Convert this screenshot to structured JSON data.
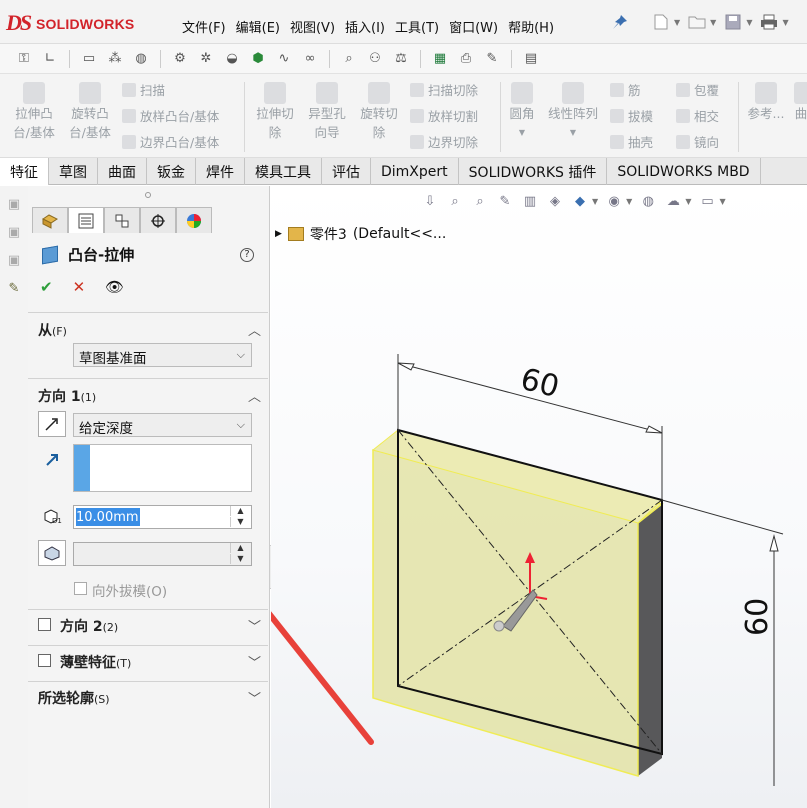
{
  "app": {
    "brand_ds": "DS",
    "brand_name": "SOLIDWORKS"
  },
  "menu": [
    "文件(F)",
    "编辑(E)",
    "视图(V)",
    "插入(I)",
    "工具(T)",
    "窗口(W)",
    "帮助(H)"
  ],
  "command_manager": {
    "big_buttons": [
      {
        "line1": "拉伸凸",
        "line2": "台/基体"
      },
      {
        "line1": "旋转凸",
        "line2": "台/基体"
      },
      {
        "line1": "拉伸切",
        "line2": "除"
      },
      {
        "line1": "异型孔",
        "line2": "向导"
      },
      {
        "line1": "旋转切",
        "line2": "除"
      }
    ],
    "small_buttons_col1": [
      "扫描",
      "放样凸台/基体",
      "边界凸台/基体"
    ],
    "small_buttons_col2": [
      "扫描切除",
      "放样切割",
      "边界切除"
    ],
    "col3": [
      {
        "line1": "圆角"
      },
      {
        "line1": "线性阵列"
      }
    ],
    "small_buttons_col4": [
      "筋",
      "拔模",
      "抽壳"
    ],
    "small_buttons_col5": [
      "包覆",
      "相交",
      "镜向"
    ],
    "col6": "参考...",
    "col7": "曲"
  },
  "tabs": [
    "特征",
    "草图",
    "曲面",
    "钣金",
    "焊件",
    "模具工具",
    "评估",
    "DimXpert",
    "SOLIDWORKS 插件",
    "SOLIDWORKS MBD"
  ],
  "property_manager": {
    "title": "凸台-拉伸",
    "help": "?",
    "ok": "✔",
    "cancel": "✕",
    "preview": "👁",
    "from": {
      "label": "从",
      "key": "(F)",
      "value": "草图基准面"
    },
    "direction1": {
      "label": "方向 1",
      "key": "(1)",
      "end_condition": "给定深度",
      "depth": "10.00mm",
      "draft_outward": "向外拔模(O)"
    },
    "direction2": {
      "label": "方向 2",
      "key": "(2)"
    },
    "thin_feature": {
      "label": "薄壁特征",
      "key": "(T)"
    },
    "selected_contours": {
      "label": "所选轮廓",
      "key": "(S)"
    }
  },
  "tree": {
    "part": "零件3",
    "config": "(Default<<..."
  },
  "model": {
    "dimension_width": "60",
    "dimension_height": "60",
    "face_color": "#e6e6a8",
    "edge_highlight": "#f2f060",
    "arrow_color": "#e8413a"
  }
}
